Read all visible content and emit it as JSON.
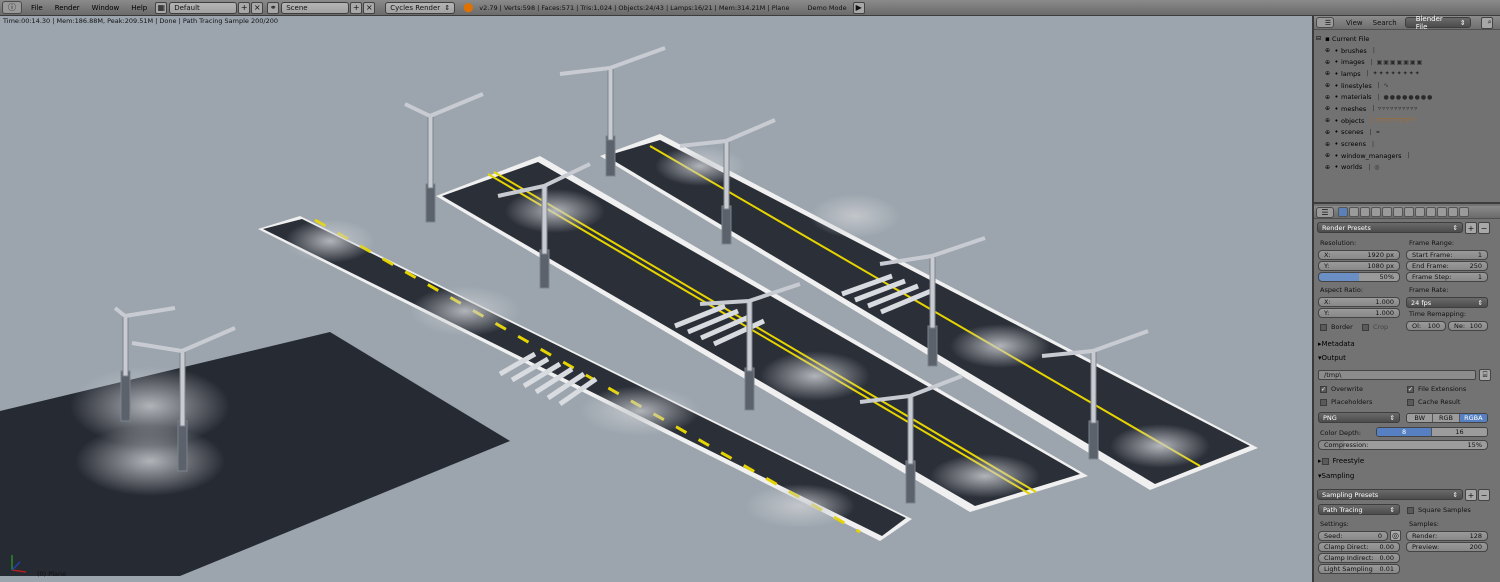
{
  "topbar": {
    "menus": [
      "File",
      "Render",
      "Window",
      "Help"
    ],
    "layout": "Default",
    "scene": "Scene",
    "engine": "Cycles Render",
    "stats": "v2.79 | Verts:598 | Faces:571 | Tris:1,024 | Objects:24/43 | Lamps:16/21 | Mem:314.21M | Plane",
    "demo_mode": "Demo Mode"
  },
  "viewport": {
    "info": "Time:00:14.30 | Mem:186.88M, Peak:209.51M | Done | Path Tracing Sample 200/200",
    "object_label": "(0) Plane"
  },
  "outliner": {
    "view": "View",
    "search": "Search",
    "display_mode": "Blender File",
    "root": "Current File",
    "items": [
      "brushes",
      "images",
      "lamps",
      "linestyles",
      "materials",
      "meshes",
      "objects",
      "scenes",
      "screens",
      "window_managers",
      "worlds"
    ]
  },
  "render": {
    "presets": "Render Presets",
    "resolution_label": "Resolution:",
    "res_x_label": "X:",
    "res_x": "1920 px",
    "res_y_label": "Y:",
    "res_y": "1080 px",
    "res_pct": "50%",
    "frame_range_label": "Frame Range:",
    "start_label": "Start Frame:",
    "start": "1",
    "end_label": "End Frame:",
    "end": "250",
    "step_label": "Frame Step:",
    "step": "1",
    "aspect_label": "Aspect Ratio:",
    "asp_x_label": "X:",
    "asp_x": "1.000",
    "asp_y_label": "Y:",
    "asp_y": "1.000",
    "frame_rate_label": "Frame Rate:",
    "fps": "24 fps",
    "time_remap_label": "Time Remapping:",
    "old_label": "Ol:",
    "old": "100",
    "new_label": "Ne:",
    "new": "100",
    "border": "Border",
    "crop": "Crop",
    "metadata": "Metadata",
    "output": "Output",
    "path": "/tmp\\",
    "overwrite": "Overwrite",
    "file_extensions": "File Extensions",
    "placeholders": "Placeholders",
    "cache_result": "Cache Result",
    "format": "PNG",
    "bw": "BW",
    "rgb": "RGB",
    "rgba": "RGBA",
    "color_depth_label": "Color Depth:",
    "depth_8": "8",
    "depth_16": "16",
    "compression_label": "Compression:",
    "compression": "15%",
    "freestyle": "Freestyle",
    "sampling": "Sampling",
    "sampling_presets": "Sampling Presets",
    "integrator": "Path Tracing",
    "square_samples": "Square Samples",
    "settings_label": "Settings:",
    "samples_label": "Samples:",
    "seed_label": "Seed:",
    "seed": "0",
    "clamp_direct_label": "Clamp Direct:",
    "clamp_direct": "0.00",
    "clamp_indirect_label": "Clamp Indirect:",
    "clamp_indirect": "0.00",
    "light_sampling_label": "Light Sampling",
    "light_sampling": "0.01",
    "render_label": "Render:",
    "render_samples": "128",
    "preview_label": "Preview:",
    "preview_samples": "200"
  }
}
